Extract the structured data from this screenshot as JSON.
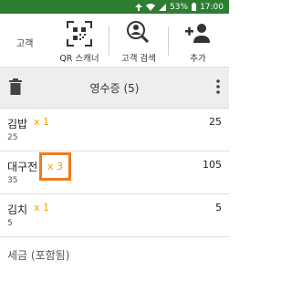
{
  "status_bar": {
    "battery": "53%",
    "time": "17:00",
    "icons": [
      "up-arrow-icon",
      "wifi-icon",
      "signal-icon",
      "battery-icon"
    ]
  },
  "toolbar": {
    "left_label": "고객",
    "items": [
      {
        "label": "QR 스캐너",
        "icon": "qr-scanner-icon"
      },
      {
        "label": "고객 검색",
        "icon": "customer-search-icon"
      },
      {
        "label": "추가",
        "icon": "add-person-icon"
      }
    ]
  },
  "receipt": {
    "title": "영수증 (5)",
    "items": [
      {
        "name": "김밥",
        "qty": "x 1",
        "unit_price": "25",
        "total": "25"
      },
      {
        "name": "대구전",
        "qty": "x 3",
        "unit_price": "35",
        "total": "105"
      },
      {
        "name": "김치",
        "qty": "x 1",
        "unit_price": "5",
        "total": "5"
      }
    ],
    "tax_label": "세금 (포함됨)"
  },
  "colors": {
    "status_bar": "#2e7d32",
    "qty": "#f2a000",
    "highlight_border": "#f07a1a",
    "header_bg": "#eeeeee"
  }
}
